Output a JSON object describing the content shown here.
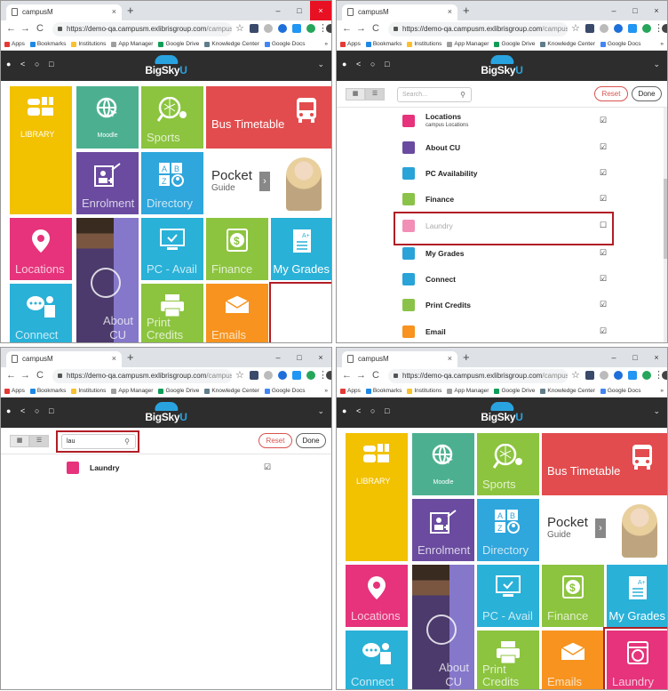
{
  "browser": {
    "tab_title": "campusM",
    "tab_close": "×",
    "new_tab": "+",
    "win_min": "–",
    "win_max": "□",
    "win_close": "×",
    "back": "←",
    "forward": "→",
    "reload": "C",
    "url_main": "https://demo-qa.campusm.exlibrisgroup.com",
    "url_rest": "/campusm/h...",
    "bookmarks": [
      {
        "label": "Apps",
        "color": "#e53935"
      },
      {
        "label": "Bookmarks",
        "color": "#1e88e5"
      },
      {
        "label": "Institutions",
        "color": "#fbc02d"
      },
      {
        "label": "App Manager",
        "color": "#9e9e9e"
      },
      {
        "label": "Google Drive",
        "color": "#0f9d58"
      },
      {
        "label": "Knowledge Center",
        "color": "#607d8b"
      },
      {
        "label": "Google Docs",
        "color": "#4285f4"
      }
    ],
    "bookmarks_more": "»",
    "menu": "⋮",
    "star": "☆"
  },
  "app": {
    "logo_big": "BigSky",
    "logo_u": "U",
    "header_chevron": "⌄"
  },
  "tiles": {
    "library": "LIBRARY",
    "moodle": "Moodle",
    "sports": "Sports",
    "bus": "Bus Timetable",
    "enrolment": "Enrolment",
    "directory": "Directory",
    "pocket": "Pocket",
    "pocket_sub": "Guide",
    "pocket_arrow": "›",
    "locations": "Locations",
    "pc": "PC - Avail",
    "finance": "Finance",
    "grades": "My Grades",
    "connect": "Connect",
    "about1": "About",
    "about2": "CU",
    "print1": "Print",
    "print2": "Credits",
    "emails": "Emails",
    "laundry": "Laundry"
  },
  "list": {
    "search_placeholder": "Search...",
    "search_typed": "lau",
    "reset": "Reset",
    "done": "Done",
    "grid_btn": "▦",
    "list_btn": "☰",
    "search_glyph": "⚲",
    "checked": "☑",
    "unchecked": "☐",
    "rows": [
      {
        "label": "Locations",
        "sub": "campus Locations",
        "color": "#e6337b"
      },
      {
        "label": "About CU",
        "color": "#6a4ba0"
      },
      {
        "label": "PC Availability",
        "color": "#29a3d8"
      },
      {
        "label": "Finance",
        "color": "#8bc34a"
      },
      {
        "label": "Laundry",
        "color": "#e6337b"
      },
      {
        "label": "My Grades",
        "color": "#29a3d8"
      },
      {
        "label": "Connect",
        "color": "#29a3d8"
      },
      {
        "label": "Print Credits",
        "color": "#8bc34a"
      },
      {
        "label": "Email",
        "color": "#f7931e"
      }
    ],
    "filtered_row": "Laundry"
  },
  "colors": {
    "library": "#f2c100",
    "moodle": "#4cb090",
    "sports": "#8cc43f",
    "bus": "#e24c4e",
    "enrolment": "#6a4ba0",
    "directory": "#2fa6dc",
    "locations": "#e6337b",
    "about": "#8577c9",
    "pc": "#29b1d8",
    "finance": "#8cc43f",
    "grades": "#29b1d8",
    "connect": "#29b1d8",
    "print": "#8cc43f",
    "emails": "#f7931e",
    "laundry": "#e6337b",
    "highlight": "#b11d25"
  }
}
